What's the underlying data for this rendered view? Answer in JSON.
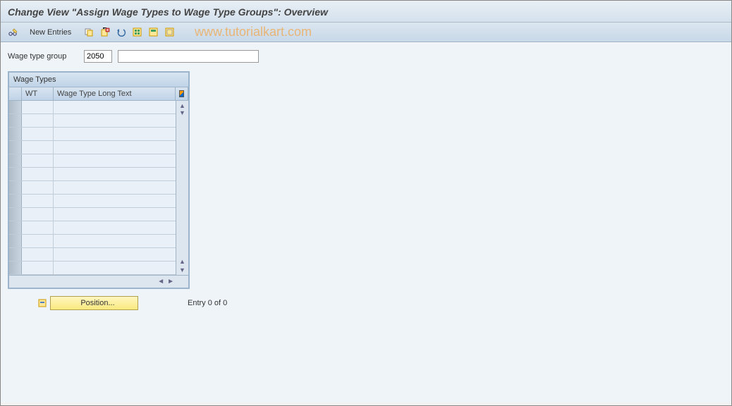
{
  "title": "Change View \"Assign Wage Types to Wage Type Groups\": Overview",
  "watermark": "www.tutorialkart.com",
  "toolbar": {
    "new_entries": "New Entries"
  },
  "form": {
    "wage_type_group_label": "Wage type group",
    "wage_type_group_code": "2050",
    "wage_type_group_desc": ""
  },
  "grid": {
    "title": "Wage Types",
    "col_wt": "WT",
    "col_long": "Wage Type Long Text"
  },
  "footer": {
    "position_label": "Position...",
    "entry_status": "Entry 0 of 0"
  }
}
